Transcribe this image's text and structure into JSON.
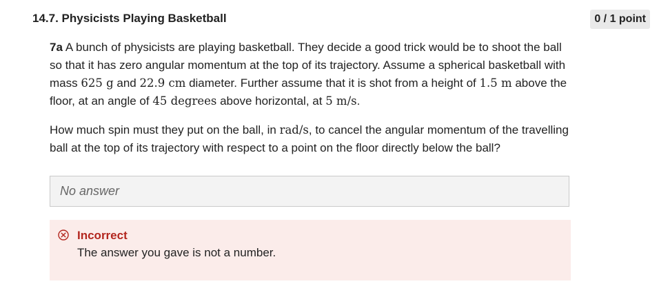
{
  "header": {
    "title": "14.7. Physicists Playing Basketball",
    "points": "0 / 1 point"
  },
  "question": {
    "number": "7a",
    "p1": {
      "t1": "A bunch of physicists are playing basketball.  They decide a good trick would be to shoot the ball so that it has zero angular momentum at the top of its trajectory.   Assume a spherical basketball with mass ",
      "m1": "625 g",
      "t2": " and ",
      "m2": "22.9 cm",
      "t3": " diameter. Further assume that it is shot from a height of ",
      "m3": "1.5 m",
      "t4": " above the floor, at an angle of ",
      "m4": "45 degrees",
      "t5": " above horizontal, at ",
      "m5": "5 m/s",
      "t6": "."
    },
    "p2": {
      "t1": "How much spin must they put on the ball, in ",
      "m1": "rad/s",
      "t2": ", to cancel the angular momentum of the travelling ball at the top of its trajectory with respect to a point on the floor directly below the ball?"
    }
  },
  "answer": {
    "value": "No answer"
  },
  "feedback": {
    "icon": "circle-x-icon",
    "title": "Incorrect",
    "message": "The answer you gave is not a number.",
    "color": "#b3261e",
    "background": "#fbecea"
  }
}
